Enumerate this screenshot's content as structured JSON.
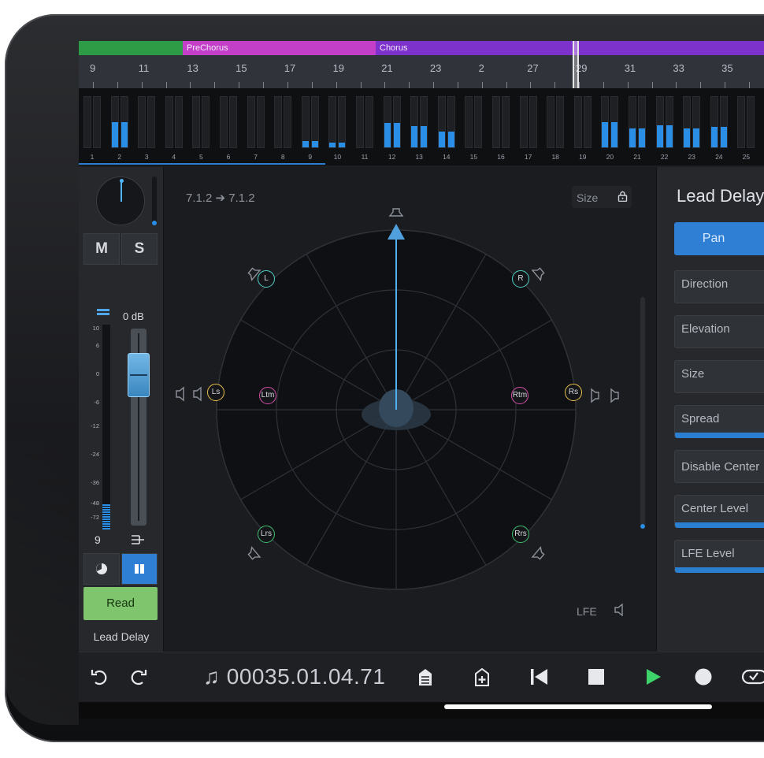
{
  "arranger": {
    "sections": [
      {
        "label": "",
        "color": "#2e9b46",
        "start": 0,
        "end": 132
      },
      {
        "label": "PreChorus",
        "color": "#c43fc8",
        "start": 132,
        "end": 377
      },
      {
        "label": "Chorus",
        "color": "#7e32cc",
        "start": 377,
        "end": 870
      }
    ]
  },
  "ruler": {
    "ticks": [
      "9",
      "11",
      "13",
      "15",
      "17",
      "19",
      "21",
      "23",
      "2",
      "27",
      "29",
      "31",
      "33",
      "35"
    ]
  },
  "track_meters": [
    {
      "num": "1",
      "level": 0
    },
    {
      "num": "2",
      "level": 0.5
    },
    {
      "num": "3",
      "level": 0
    },
    {
      "num": "4",
      "level": 0
    },
    {
      "num": "5",
      "level": 0
    },
    {
      "num": "6",
      "level": 0
    },
    {
      "num": "7",
      "level": 0
    },
    {
      "num": "8",
      "level": 0
    },
    {
      "num": "9",
      "level": 0.12
    },
    {
      "num": "10",
      "level": 0.1
    },
    {
      "num": "11",
      "level": 0
    },
    {
      "num": "12",
      "level": 0.48
    },
    {
      "num": "13",
      "level": 0.42
    },
    {
      "num": "14",
      "level": 0.32
    },
    {
      "num": "15",
      "level": 0
    },
    {
      "num": "16",
      "level": 0
    },
    {
      "num": "17",
      "level": 0
    },
    {
      "num": "18",
      "level": 0
    },
    {
      "num": "19",
      "level": 0
    },
    {
      "num": "20",
      "level": 0.5
    },
    {
      "num": "21",
      "level": 0.38
    },
    {
      "num": "22",
      "level": 0.44
    },
    {
      "num": "23",
      "level": 0.38
    },
    {
      "num": "24",
      "level": 0.4
    },
    {
      "num": "25",
      "level": 0
    }
  ],
  "channel": {
    "mute": "M",
    "solo": "S",
    "volume_db": "0 dB",
    "scale": [
      "10",
      "6",
      "0",
      "-6",
      "-12",
      "-24",
      "-36",
      "-48",
      "-72"
    ],
    "number": "9",
    "automation_mode": "Read",
    "name": "Lead Delay",
    "fader_level": 0.2
  },
  "panner": {
    "format": "7.1.2 ➔ 7.1.2",
    "size_label": "Size",
    "lfe_label": "LFE",
    "speakers": [
      {
        "id": "L",
        "color": "#4fd1c5"
      },
      {
        "id": "R",
        "color": "#4fd1c5"
      },
      {
        "id": "Ls",
        "color": "#e6c04a"
      },
      {
        "id": "Rs",
        "color": "#e6c04a"
      },
      {
        "id": "Ltm",
        "color": "#d24da6"
      },
      {
        "id": "Rtm",
        "color": "#d24da6"
      },
      {
        "id": "Lrs",
        "color": "#3ec070"
      },
      {
        "id": "Rrs",
        "color": "#3ec070"
      }
    ]
  },
  "panel": {
    "title": "Lead Delay",
    "pan_button": "Pan",
    "params": [
      {
        "label": "Direction",
        "level": 0
      },
      {
        "label": "Elevation",
        "level": 0
      },
      {
        "label": "Size",
        "level": 0
      },
      {
        "label": "Spread",
        "level": 1
      },
      {
        "label": "Disable Center",
        "level": 0
      },
      {
        "label": "Center Level",
        "level": 1
      },
      {
        "label": "LFE Level",
        "level": 1
      }
    ]
  },
  "transport": {
    "time": "♫ 00035.01.04.71"
  }
}
